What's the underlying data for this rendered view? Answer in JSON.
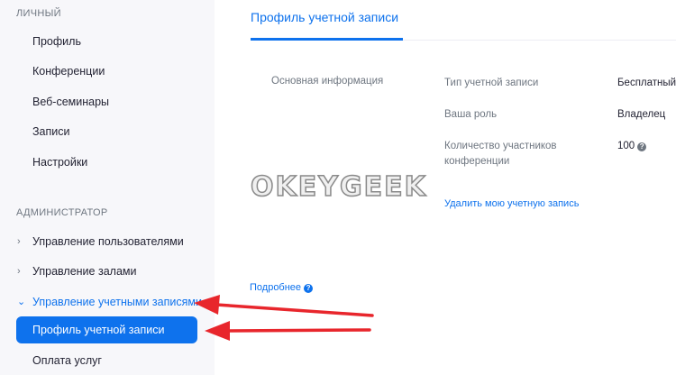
{
  "sidebar": {
    "personal_title": "ЛИЧНЫЙ",
    "personal_items": [
      "Профиль",
      "Конференции",
      "Веб-семинары",
      "Записи",
      "Настройки"
    ],
    "admin_title": "АДМИНИСТРАТОР",
    "admin_items": {
      "users": "Управление пользователями",
      "rooms": "Управление залами",
      "accounts": "Управление учетными записями",
      "account_profile": "Профиль учетной записи",
      "billing": "Оплата услуг"
    }
  },
  "main": {
    "title": "Профиль учетной записи",
    "section_label": "Основная информация",
    "fields": [
      {
        "label": "Тип учетной записи",
        "value": "Бесплатный"
      },
      {
        "label": "Ваша роль",
        "value": "Владелец"
      },
      {
        "label_line1": "Количество участников",
        "label_line2": "конференции",
        "value": "100"
      }
    ],
    "delete_link": "Удалить мою учетную запись",
    "more_link": "Подробнее"
  },
  "watermark": "OKEYGEEK",
  "colors": {
    "accent": "#0e72ed",
    "annotation_arrow": "#e8262c"
  },
  "icons": {
    "chevron": "chevron-right-icon",
    "help": "question-circle-icon"
  }
}
